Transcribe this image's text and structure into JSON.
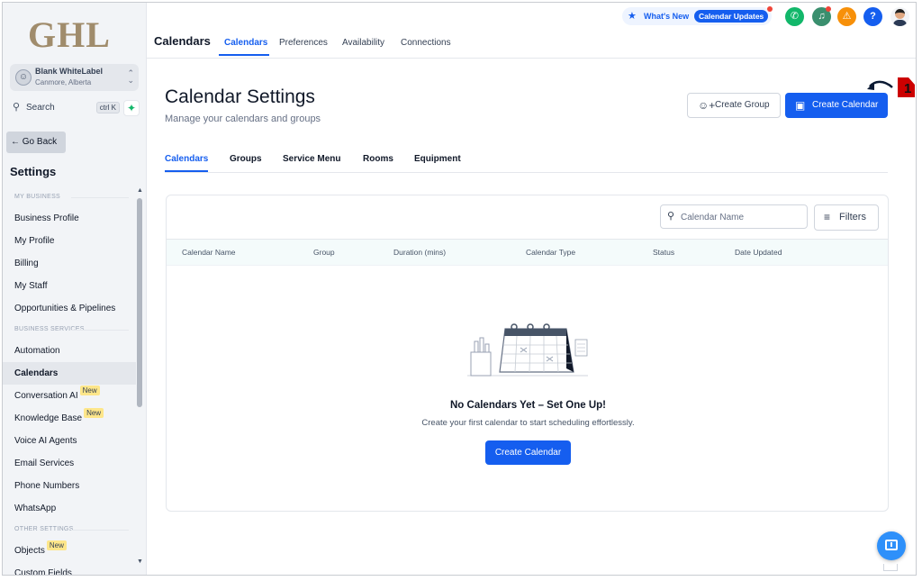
{
  "brand": {
    "logo_text": "GHL"
  },
  "account": {
    "name": "Blank WhiteLabel",
    "location": "Canmore, Alberta",
    "avatar_icon": "user-icon"
  },
  "sidebar": {
    "search_label": "Search",
    "search_shortcut": "ctrl K",
    "go_back_label": "Go Back",
    "settings_title": "Settings",
    "sections": [
      {
        "title": "MY BUSINESS",
        "items": [
          {
            "label": "Business Profile"
          },
          {
            "label": "My Profile"
          },
          {
            "label": "Billing"
          },
          {
            "label": "My Staff"
          },
          {
            "label": "Opportunities & Pipelines"
          }
        ]
      },
      {
        "title": "BUSINESS SERVICES",
        "items": [
          {
            "label": "Automation"
          },
          {
            "label": "Calendars",
            "active": true
          },
          {
            "label": "Conversation AI",
            "badge": "New"
          },
          {
            "label": "Knowledge Base",
            "badge": "New"
          },
          {
            "label": "Voice AI Agents"
          },
          {
            "label": "Email Services"
          },
          {
            "label": "Phone Numbers"
          },
          {
            "label": "WhatsApp"
          }
        ]
      },
      {
        "title": "OTHER SETTINGS",
        "items": [
          {
            "label": "Objects",
            "badge": "New"
          },
          {
            "label": "Custom Fields"
          }
        ]
      }
    ]
  },
  "topbar": {
    "title": "Calendars",
    "tabs": [
      {
        "label": "Calendars",
        "active": true
      },
      {
        "label": "Preferences"
      },
      {
        "label": "Availability"
      },
      {
        "label": "Connections"
      }
    ],
    "whats_new_label": "What's New",
    "whats_new_badge": "Calendar Updates",
    "icons": [
      "phone-icon",
      "megaphone-icon",
      "bell-icon",
      "help-icon"
    ]
  },
  "main": {
    "title": "Calendar Settings",
    "subtitle": "Manage your calendars and groups",
    "create_group_label": "Create Group",
    "create_calendar_label": "Create Calendar",
    "annotation_number": "1",
    "tabs": [
      {
        "label": "Calendars",
        "active": true
      },
      {
        "label": "Groups"
      },
      {
        "label": "Service Menu"
      },
      {
        "label": "Rooms"
      },
      {
        "label": "Equipment"
      }
    ],
    "table": {
      "search_placeholder": "Calendar Name",
      "filters_label": "Filters",
      "columns": [
        "Calendar Name",
        "Group",
        "Duration (mins)",
        "Calendar Type",
        "Status",
        "Date Updated"
      ]
    },
    "empty_state": {
      "title": "No Calendars Yet – Set One Up!",
      "subtitle": "Create your first calendar to start scheduling effortlessly.",
      "button_label": "Create Calendar"
    }
  },
  "colors": {
    "primary": "#155eef",
    "sidebar_bg": "#f2f4f7",
    "annotation": "#cc0000",
    "badge": "#fde68a"
  }
}
